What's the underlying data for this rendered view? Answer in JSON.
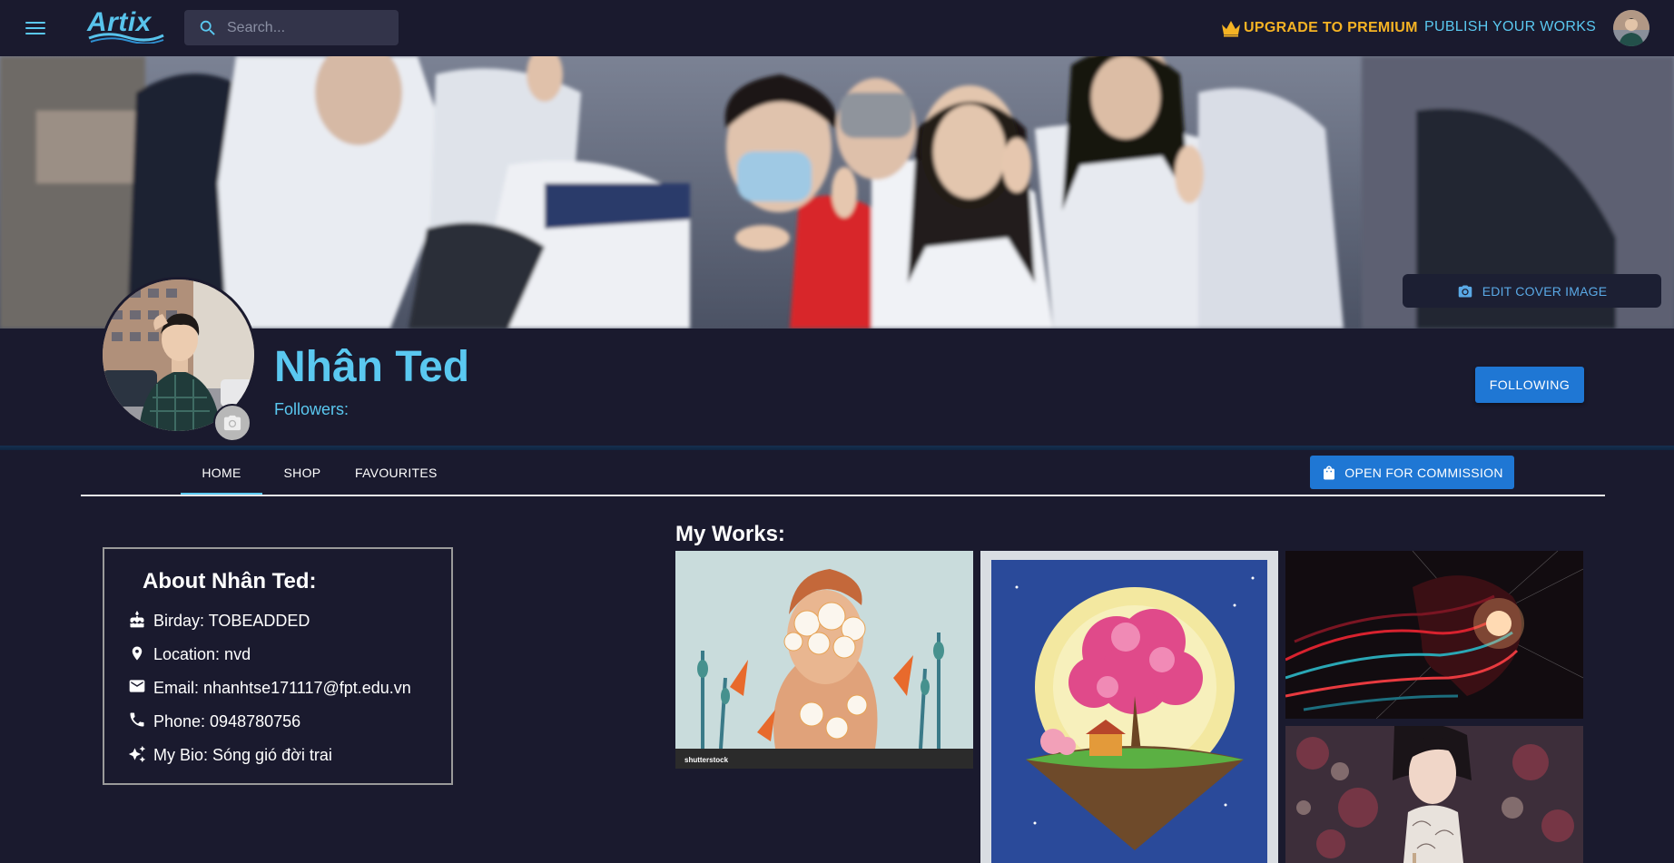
{
  "header": {
    "logo_text": "Artix",
    "search_placeholder": "Search...",
    "upgrade_label": "UPGRADE TO PREMIUM",
    "publish_label": "PUBLISH YOUR WORKS"
  },
  "cover": {
    "edit_label": "EDIT COVER IMAGE"
  },
  "profile": {
    "name": "Nhân Ted",
    "followers_label": "Followers:",
    "following_label": "FOLLOWING"
  },
  "tabs": [
    {
      "label": "HOME"
    },
    {
      "label": "SHOP"
    },
    {
      "label": "FAVOURITES"
    }
  ],
  "commission_label": "OPEN FOR COMMISSION",
  "about": {
    "title": "About Nhân Ted:",
    "items": [
      {
        "icon": "cake-icon",
        "text": "Birday: TOBEADDED"
      },
      {
        "icon": "location-pin-icon",
        "text": "Location: nvd"
      },
      {
        "icon": "mail-icon",
        "text": "Email: nhanhtse171117@fpt.edu.vn"
      },
      {
        "icon": "phone-icon",
        "text": "Phone: 0948780756"
      },
      {
        "icon": "sparkle-icon",
        "text": "My Bio: Sóng gió đời trai"
      }
    ]
  },
  "works": {
    "title": "My Works:",
    "watermark": "shutterstock"
  },
  "colors": {
    "background": "#1a1a2e",
    "accent": "#5ac8f0",
    "premium": "#f5b324",
    "button": "#1f77d4"
  }
}
